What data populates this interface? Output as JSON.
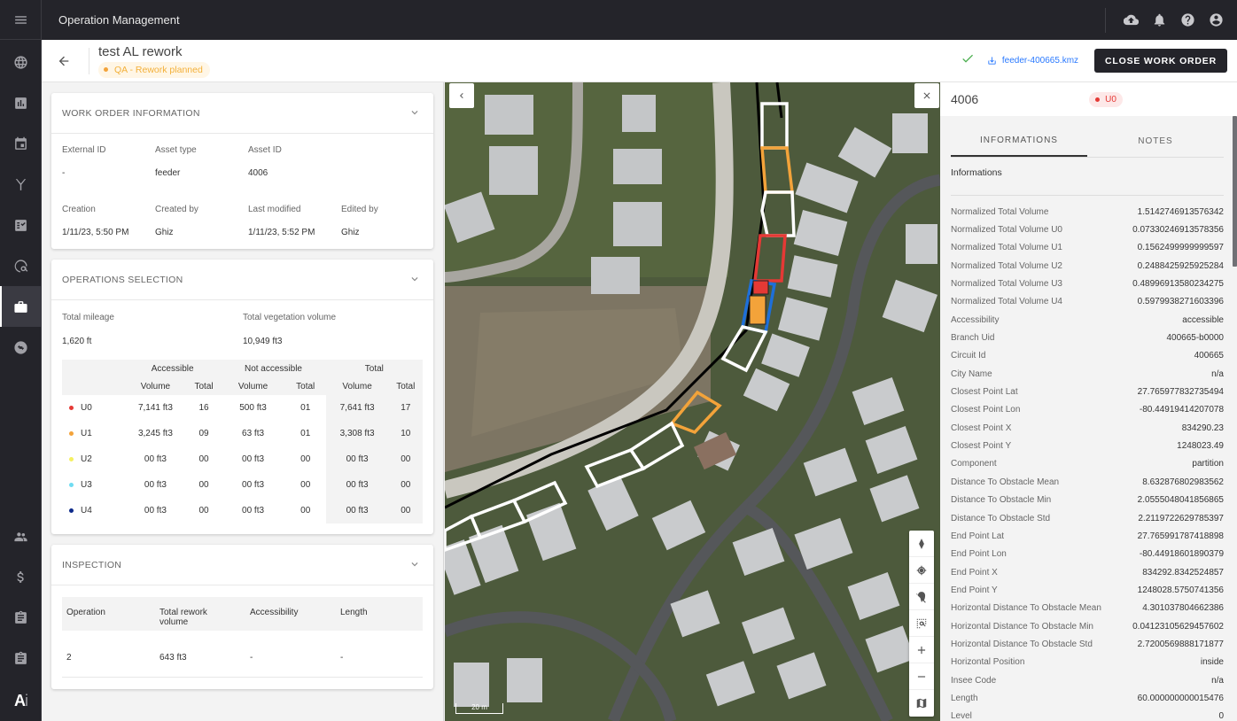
{
  "app": {
    "title": "Operation Management"
  },
  "sidebar": {
    "items": [
      {
        "name": "globe",
        "active": false
      },
      {
        "name": "chart",
        "active": false
      },
      {
        "name": "calendar",
        "active": false
      },
      {
        "name": "antenna",
        "active": false
      },
      {
        "name": "checklist",
        "active": false
      },
      {
        "name": "search-globe",
        "active": false
      },
      {
        "name": "briefcase",
        "active": true
      },
      {
        "name": "sync",
        "active": false
      }
    ],
    "bottom_items": [
      {
        "name": "users"
      },
      {
        "name": "dollar"
      },
      {
        "name": "clipboard"
      },
      {
        "name": "clipboard"
      }
    ],
    "logo_main": "A",
    "logo_sub": "i"
  },
  "topbar_icons": [
    "cloud-upload",
    "bell",
    "help",
    "account"
  ],
  "header": {
    "title": "test AL rework",
    "status": "QA - Rework planned",
    "status_color": "#f3a33a",
    "kmz_file": "feeder-400665.kmz",
    "close_button": "CLOSE WORK ORDER"
  },
  "work_order": {
    "title": "WORK ORDER INFORMATION",
    "fields": [
      {
        "label": "External ID",
        "value": "-"
      },
      {
        "label": "Asset type",
        "value": "feeder"
      },
      {
        "label": "Asset ID",
        "value": "4006"
      },
      {
        "label": "Creation",
        "value": "1/11/23, 5:50 PM"
      },
      {
        "label": "Created by",
        "value": "Ghiz"
      },
      {
        "label": "Last modified",
        "value": "1/11/23, 5:52 PM"
      },
      {
        "label": "Edited by",
        "value": "Ghiz"
      }
    ]
  },
  "operations": {
    "title": "OPERATIONS SELECTION",
    "mileage_label": "Total mileage",
    "mileage_value": "1,620 ft",
    "veg_label": "Total vegetation volume",
    "veg_value": "10,949 ft3",
    "group_headers": [
      "Accessible",
      "Not accessible",
      "Total"
    ],
    "sub_headers": [
      "Volume",
      "Total",
      "Volume",
      "Total",
      "Volume",
      "Total"
    ],
    "rows": [
      {
        "name": "U0",
        "color": "#e53935",
        "cells": [
          "7,141 ft3",
          "16",
          "500 ft3",
          "01",
          "7,641 ft3",
          "17"
        ]
      },
      {
        "name": "U1",
        "color": "#f3a33a",
        "cells": [
          "3,245 ft3",
          "09",
          "63 ft3",
          "01",
          "3,308 ft3",
          "10"
        ]
      },
      {
        "name": "U2",
        "color": "#f5f060",
        "cells": [
          "00 ft3",
          "00",
          "00 ft3",
          "00",
          "00 ft3",
          "00"
        ]
      },
      {
        "name": "U3",
        "color": "#6fdcf2",
        "cells": [
          "00 ft3",
          "00",
          "00 ft3",
          "00",
          "00 ft3",
          "00"
        ]
      },
      {
        "name": "U4",
        "color": "#0d2a8a",
        "cells": [
          "00 ft3",
          "00",
          "00 ft3",
          "00",
          "00 ft3",
          "00"
        ]
      }
    ]
  },
  "inspection": {
    "title": "INSPECTION",
    "headers": [
      "Operation",
      "Total rework volume",
      "Accessibility",
      "Length"
    ],
    "rows": [
      [
        "2",
        "643 ft3",
        "-",
        "-"
      ]
    ]
  },
  "map": {
    "scale_label": "20 m",
    "controls": [
      "compass",
      "locate",
      "location-off",
      "zoom-area",
      "zoom-in",
      "zoom-out",
      "map-layers"
    ]
  },
  "details": {
    "asset_id": "4006",
    "chip": "U0",
    "chip_color": "#e53935",
    "tabs": [
      "INFORMATIONS",
      "NOTES"
    ],
    "active_tab": 0,
    "section_title": "Informations",
    "properties": [
      {
        "k": "Normalized Total Volume",
        "v": "1.5142746913576342"
      },
      {
        "k": "Normalized Total Volume U0",
        "v": "0.07330246913578356"
      },
      {
        "k": "Normalized Total Volume U1",
        "v": "0.1562499999999597"
      },
      {
        "k": "Normalized Total Volume U2",
        "v": "0.2488425925925284"
      },
      {
        "k": "Normalized Total Volume U3",
        "v": "0.48996913580234275"
      },
      {
        "k": "Normalized Total Volume U4",
        "v": "0.5979938271603396"
      },
      {
        "k": "Accessibility",
        "v": "accessible"
      },
      {
        "k": "Branch Uid",
        "v": "400665-b0000"
      },
      {
        "k": "Circuit Id",
        "v": "400665"
      },
      {
        "k": "City Name",
        "v": "n/a"
      },
      {
        "k": "Closest Point Lat",
        "v": "27.765977832735494"
      },
      {
        "k": "Closest Point Lon",
        "v": "-80.44919414207078"
      },
      {
        "k": "Closest Point X",
        "v": "834290.23"
      },
      {
        "k": "Closest Point Y",
        "v": "1248023.49"
      },
      {
        "k": "Component",
        "v": "partition"
      },
      {
        "k": "Distance To Obstacle Mean",
        "v": "8.632876802983562"
      },
      {
        "k": "Distance To Obstacle Min",
        "v": "2.0555048041856865"
      },
      {
        "k": "Distance To Obstacle Std",
        "v": "2.2119722629785397"
      },
      {
        "k": "End Point Lat",
        "v": "27.765991787418898"
      },
      {
        "k": "End Point Lon",
        "v": "-80.44918601890379"
      },
      {
        "k": "End Point X",
        "v": "834292.8342524857"
      },
      {
        "k": "End Point Y",
        "v": "1248028.5750741356"
      },
      {
        "k": "Horizontal Distance To Obstacle Mean",
        "v": "4.301037804662386"
      },
      {
        "k": "Horizontal Distance To Obstacle Min",
        "v": "0.04123105629457602"
      },
      {
        "k": "Horizontal Distance To Obstacle Std",
        "v": "2.7200569888171877"
      },
      {
        "k": "Horizontal Position",
        "v": "inside"
      },
      {
        "k": "Insee Code",
        "v": "n/a"
      },
      {
        "k": "Length",
        "v": "60.000000000015476"
      },
      {
        "k": "Level",
        "v": "0"
      }
    ]
  }
}
